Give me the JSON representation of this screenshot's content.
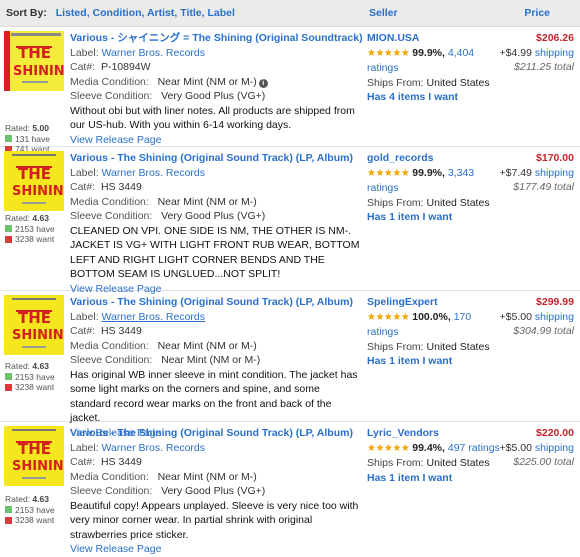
{
  "header": {
    "sort_label": "Sort By:",
    "sort_options": [
      "Listed",
      "Condition",
      "Artist",
      "Title",
      "Label"
    ],
    "seller_label": "Seller",
    "price_label": "Price"
  },
  "listings": [
    {
      "title": "Various - シャイニング = The Shining (Original Soundtrack) (LP)",
      "label_key": "Label:",
      "label": "Warner Bros. Records",
      "cat_key": "Cat#:",
      "cat": "P-10894W",
      "media_key": "Media Condition:",
      "media": "Near Mint (NM or M-)",
      "sleeve_key": "Sleeve Condition:",
      "sleeve": "Very Good Plus (VG+)",
      "comment": "Without obi but with liner notes. All products are shipped from our US-hub. With you within 6-14 working days.",
      "view": "View Release Page",
      "rated": "Rated:",
      "rating": "5.00",
      "have": "131 have",
      "want": "741 want",
      "seller": "MION.USA",
      "stars": "★★★★★",
      "pct": "99.9%,",
      "ratings_count": "4,404",
      "ratings_word": "ratings",
      "ships_key": "Ships From:",
      "ships": "United States",
      "has": "Has 4 items I want",
      "price": "$206.26",
      "shipping": "+$4.99",
      "shipping_word": "shipping",
      "total": "$211.25 total",
      "cover": "red",
      "info_icon": "info-icon"
    },
    {
      "title": "Various - The Shining (Original Sound Track) (LP, Album)",
      "label_key": "Label:",
      "label": "Warner Bros. Records",
      "cat_key": "Cat#:",
      "cat": "HS 3449",
      "media_key": "Media Condition:",
      "media": "Near Mint (NM or M-)",
      "sleeve_key": "Sleeve Condition:",
      "sleeve": "Very Good Plus (VG+)",
      "comment": "CLEANED ON VPI. ONE SIDE IS NM, THE OTHER IS NM-. JACKET IS VG+ WITH LIGHT FRONT RUB WEAR, BOTTOM LEFT AND RIGHT LIGHT CORNER BENDS AND THE BOTTOM SEAM IS UNGLUED...NOT SPLIT!",
      "view": "View Release Page",
      "rated": "Rated:",
      "rating": "4.63",
      "have": "2153 have",
      "want": "3238 want",
      "seller": "gold_records",
      "stars": "★★★★★",
      "pct": "99.9%,",
      "ratings_count": "3,343",
      "ratings_word": "ratings",
      "ships_key": "Ships From:",
      "ships": "United States",
      "has": "Has 1 item I want",
      "price": "$170.00",
      "shipping": "+$7.49",
      "shipping_word": "shipping",
      "total": "$177.49 total",
      "cover": "yellow"
    },
    {
      "title": "Various - The Shining (Original Sound Track) (LP, Album)",
      "label_key": "Label:",
      "label": "Warner Bros. Records",
      "cat_key": "Cat#:",
      "cat": "HS 3449",
      "media_key": "Media Condition:",
      "media": "Near Mint (NM or M-)",
      "sleeve_key": "Sleeve Condition:",
      "sleeve": "Near Mint (NM or M-)",
      "comment": "Has original WB inner sleeve in mint condition. The jacket has some light marks on the corners and spine, and some standard record wear marks on the front and back of the jacket.",
      "view": "View Release Page",
      "rated": "Rated:",
      "rating": "4.63",
      "have": "2153 have",
      "want": "3238 want",
      "seller": "SpelingExpert",
      "stars": "★★★★★",
      "pct": "100.0%,",
      "ratings_count": "170",
      "ratings_word": "ratings",
      "ships_key": "Ships From:",
      "ships": "United States",
      "has": "Has 1 item I want",
      "price": "$299.99",
      "shipping": "+$5.00",
      "shipping_word": "shipping",
      "total": "$304.99 total",
      "cover": "yellow"
    },
    {
      "title": "Various - The Shining (Original Sound Track) (LP, Album)",
      "label_key": "Label:",
      "label": "Warner Bros. Records",
      "cat_key": "Cat#:",
      "cat": "HS 3449",
      "media_key": "Media Condition:",
      "media": "Near Mint (NM or M-)",
      "sleeve_key": "Sleeve Condition:",
      "sleeve": "Very Good Plus (VG+)",
      "comment": "Beautiful copy! Appears unplayed. Sleeve is very nice too with very minor corner wear. In partial shrink with original strawberries price sticker.",
      "view": "View Release Page",
      "rated": "Rated:",
      "rating": "4.63",
      "have": "2153 have",
      "want": "3238 want",
      "seller": "Lyric_Vendors",
      "stars": "★★★★★",
      "pct": "99.4%,",
      "ratings_count": "497 ratings",
      "ratings_word": "",
      "ships_key": "Ships From:",
      "ships": "United States",
      "has": "Has 1 item I want",
      "price": "$220.00",
      "shipping": "+$5.00",
      "shipping_word": "shipping",
      "total": "$225.00 total",
      "cover": "yellow"
    }
  ]
}
